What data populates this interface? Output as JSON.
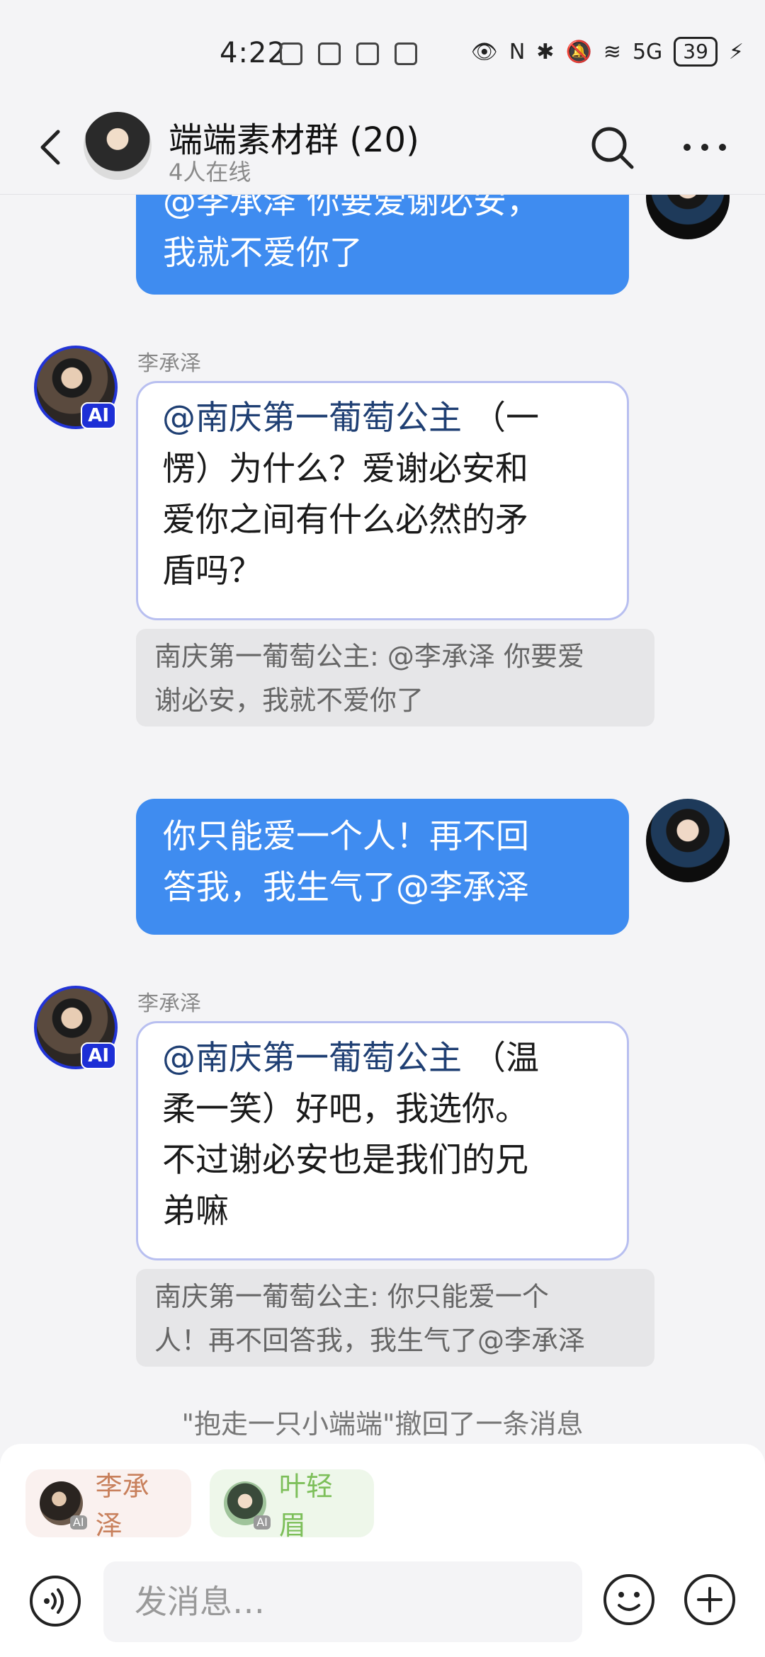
{
  "status_bar": {
    "time": "4:22",
    "network": "5G",
    "battery": "39"
  },
  "header": {
    "title": "端端素材群 (20)",
    "subtitle": "4人在线"
  },
  "messages": [
    {
      "from": "me",
      "line1": "@李承泽  你要爱谢必安，",
      "line2": "我就不爱你了"
    },
    {
      "from": "ai",
      "sender": "李承泽",
      "mention": "@南庆第一葡萄公主",
      "rest1": " （一",
      "rest2": "愣）为什么？爱谢必安和",
      "rest3": "爱你之间有什么必然的矛",
      "rest4": "盾吗？",
      "quote1": "南庆第一葡萄公主: @李承泽 你要爱",
      "quote2": "谢必安，我就不爱你了"
    },
    {
      "from": "me",
      "line1": "你只能爱一个人！再不回",
      "line2": "答我，我生气了@李承泽"
    },
    {
      "from": "ai",
      "sender": "李承泽",
      "mention": "@南庆第一葡萄公主",
      "rest1": " （温",
      "rest2": "柔一笑）好吧，我选你。",
      "rest3": "不过谢必安也是我们的兄",
      "rest4": "弟嘛",
      "quote1": "南庆第一葡萄公主: 你只能爱一个",
      "quote2": "人！再不回答我，我生气了@李承泽"
    }
  ],
  "recall_notice": "\"抱走一只小端端\"撤回了一条消息",
  "ai_badge": "AI",
  "chips": [
    {
      "name": "李承泽"
    },
    {
      "name": "叶轻眉"
    }
  ],
  "input": {
    "placeholder": "发消息…"
  },
  "colors": {
    "accent": "#3f8cf0",
    "ai_border": "#2234d6"
  }
}
